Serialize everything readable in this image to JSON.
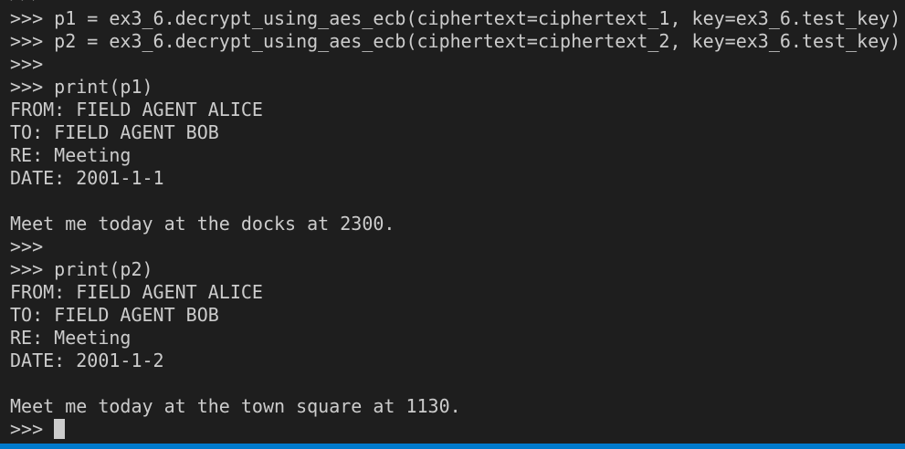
{
  "terminal": {
    "lines": [
      ">>>",
      ">>> p1 = ex3_6.decrypt_using_aes_ecb(ciphertext=ciphertext_1, key=ex3_6.test_key)",
      ">>> p2 = ex3_6.decrypt_using_aes_ecb(ciphertext=ciphertext_2, key=ex3_6.test_key)",
      ">>>",
      ">>> print(p1)",
      "FROM: FIELD AGENT ALICE",
      "TO: FIELD AGENT BOB",
      "RE: Meeting",
      "DATE: 2001-1-1",
      "",
      "Meet me today at the docks at 2300.",
      ">>>",
      ">>> print(p2)",
      "FROM: FIELD AGENT ALICE",
      "TO: FIELD AGENT BOB",
      "RE: Meeting",
      "DATE: 2001-1-2",
      "",
      "Meet me today at the town square at 1130."
    ],
    "prompt": ">>> ",
    "colors": {
      "background": "#1e1e1e",
      "foreground": "#cccccc",
      "statusbar": "#007acc"
    }
  }
}
